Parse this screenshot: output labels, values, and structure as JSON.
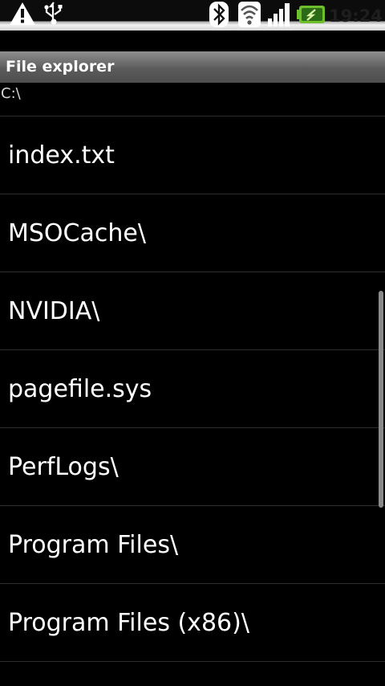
{
  "status_bar": {
    "time": "19:24",
    "icons": [
      "warning-icon",
      "usb-icon",
      "bluetooth-icon",
      "wifi-icon",
      "signal-icon",
      "battery-charging-icon"
    ]
  },
  "app": {
    "title": "File explorer"
  },
  "path": "C:\\",
  "files": [
    {
      "name": "index.txt"
    },
    {
      "name": "MSOCache\\"
    },
    {
      "name": "NVIDIA\\"
    },
    {
      "name": "pagefile.sys"
    },
    {
      "name": "PerfLogs\\"
    },
    {
      "name": "Program Files\\"
    },
    {
      "name": "Program Files (x86)\\"
    }
  ]
}
